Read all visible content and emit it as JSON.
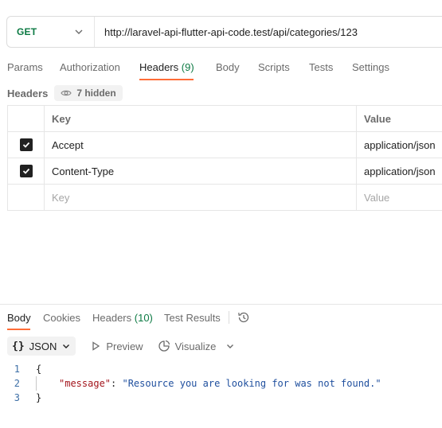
{
  "request": {
    "method": "GET",
    "url": "http://laravel-api-flutter-api-code.test/api/categories/123"
  },
  "request_tabs": [
    {
      "label": "Params"
    },
    {
      "label": "Authorization"
    },
    {
      "label": "Headers",
      "count": "(9)"
    },
    {
      "label": "Body"
    },
    {
      "label": "Scripts"
    },
    {
      "label": "Tests"
    },
    {
      "label": "Settings"
    }
  ],
  "headers_section": {
    "title": "Headers",
    "hidden_label": "7 hidden"
  },
  "headers_table": {
    "columns": {
      "key": "Key",
      "value": "Value"
    },
    "rows": [
      {
        "key": "Accept",
        "value": "application/json",
        "checked": true
      },
      {
        "key": "Content-Type",
        "value": "application/json",
        "checked": true
      }
    ],
    "empty_row": {
      "key_placeholder": "Key",
      "value_placeholder": "Value"
    }
  },
  "response_tabs": [
    {
      "label": "Body"
    },
    {
      "label": "Cookies"
    },
    {
      "label": "Headers",
      "count": "(10)"
    },
    {
      "label": "Test Results"
    }
  ],
  "response_toolbar": {
    "format": "JSON",
    "preview": "Preview",
    "visualize": "Visualize"
  },
  "response_body": {
    "lines": [
      {
        "num": "1",
        "open": "{"
      },
      {
        "num": "2",
        "key": "\"message\"",
        "colon": ": ",
        "value": "\"Resource you are looking for was not found.\""
      },
      {
        "num": "3",
        "close": "}"
      }
    ]
  },
  "colors": {
    "accent": "#ff6c37",
    "method_get": "#0c7a43",
    "json_key": "#a3151c",
    "json_string": "#1f4f9e"
  }
}
